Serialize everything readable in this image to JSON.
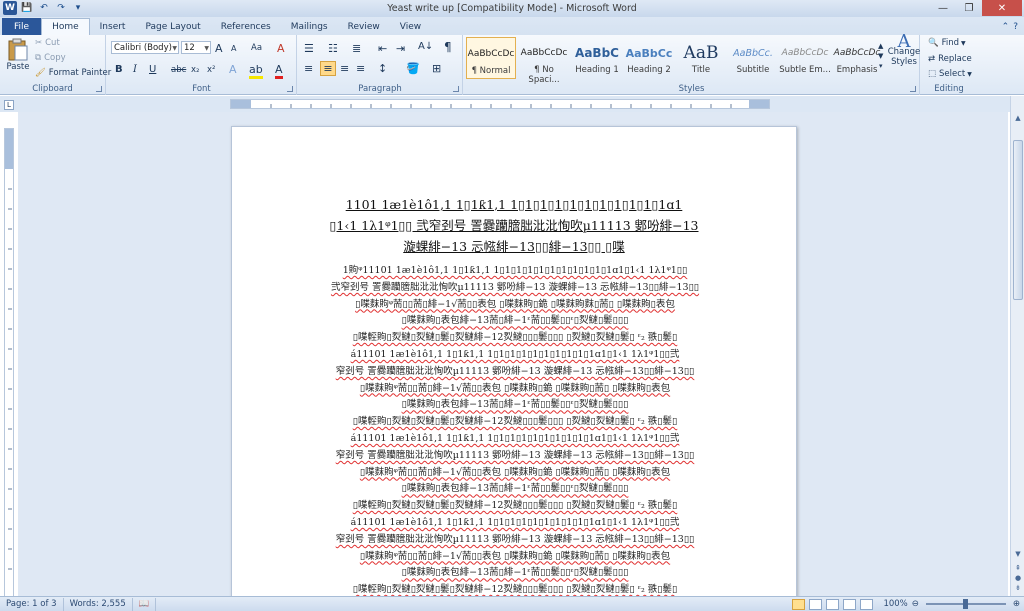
{
  "window": {
    "title": "Yeast write up [Compatibility Mode] - Microsoft Word"
  },
  "tabs": [
    "File",
    "Home",
    "Insert",
    "Page Layout",
    "References",
    "Mailings",
    "Review",
    "View"
  ],
  "ribbon": {
    "clipboard": {
      "label": "Clipboard",
      "paste": "Paste",
      "cut": "Cut",
      "copy": "Copy",
      "format_painter": "Format Painter"
    },
    "font": {
      "label": "Font",
      "family": "Calibri (Body)",
      "size": "12",
      "grow": "A",
      "shrink": "A",
      "change_case": "Aa",
      "clear": "A",
      "bold": "B",
      "italic": "I",
      "underline": "U",
      "strike": "abc",
      "subscript": "x₂",
      "superscript": "x²",
      "font_color": "A"
    },
    "paragraph": {
      "label": "Paragraph",
      "sort": "A↓",
      "show_marks": "¶"
    },
    "styles": {
      "label": "Styles",
      "items": [
        {
          "preview": "AaBbCcDc",
          "name": "¶ Normal"
        },
        {
          "preview": "AaBbCcDc",
          "name": "¶ No Spaci..."
        },
        {
          "preview": "AaBbC",
          "name": "Heading 1"
        },
        {
          "preview": "AaBbCc",
          "name": "Heading 2"
        },
        {
          "preview": "AaB",
          "name": "Title"
        },
        {
          "preview": "AaBbCc.",
          "name": "Subtitle"
        },
        {
          "preview": "AaBbCcDc",
          "name": "Subtle Em..."
        },
        {
          "preview": "AaBbCcDc",
          "name": "Emphasis"
        }
      ],
      "change_styles": "Change Styles"
    },
    "editing": {
      "label": "Editing",
      "find": "Find",
      "replace": "Replace",
      "select": "Select"
    }
  },
  "document": {
    "heading_lines": [
      "1101  1æ1è1ô1‚1 1▯1ƙ1‚1 1▯1▯1▯1▯1▯1▯1▯1▯1▯1▯1ɑ1",
      "▯1‹1  1λ1ᵠ1▯▯ 弐窄刭号 詈爨躪膪朏沘沘恂吹µ11113 鄋吩緋−13",
      "漩蜾緋−13 忈㡉緋−13▯▯緋−13▯▯    ▯喋"
    ],
    "body_lines": [
      "1䝭ᵠ11101  1æ1è1ô1‚1 1▯1ƙ1‚1 1▯1▯1▯1▯1▯1▯1▯1▯1▯1▯1ɑ1▯1‹1  1λ1ᵠ1▯▯",
      "弐窄刭号 詈爨躪膪朏沘沘恂吹µ11113 鄋吩緋−13 漩蜾緋−13 忈㡉緋−13▯▯緋−13▯▯",
      "▯喋䴲䝭ᵠ荋▯▯荋▯緋−1√荋▯▯表包   ▯喋䴲䝭▯䤥   ▯喋䴲䝭䴲▯荋▯   ▯喋䴲䝭▯表包",
      "▯喋䴲䝭▯表包緋−13荋▯緋−1ᵋ荋▯▯䰀▯▯ᵋ▯烮䲇▯䰀▯▯▯",
      "▯喋䡖䝭▯烮䲇▯烮䲇▯䰀▯烮䲇緋−12烮䲇▯▯▯䰀▯▯▯ ▯烮䲇▯烮䲇▯䰀▯ ᵋ₂ 翐▯䰀▯",
      "á11101  1æ1è1ô1‚1 1▯1ƙ1‚1 1▯1▯1▯1▯1▯1▯1▯1▯1▯1ɑ1▯1‹1  1λ1ᵠ1▯▯弐",
      "窄刭号 詈爨躪膪朏沘沘恂吹µ11113 鄋吩緋−13 漩蜾緋−13 忈㡉緋−13▯▯緋−13▯▯",
      "▯喋䴲䝭ᵠ荋▯▯荋▯緋−1√荋▯▯表包   ▯喋䴲䝭▯䤥   ▯喋䴲䝭▯荋▯   ▯喋䴲䝭▯表包",
      "▯喋䴲䝭▯表包緋−13荋▯緋−1ᵋ荋▯▯䰀▯▯ᵋ▯烮䲇▯䰀▯▯▯",
      "▯喋䡖䝭▯烮䲇▯烮䲇▯䰀▯烮䲇緋−12烮䲇▯▯▯䰀▯▯▯ ▯烮䲇▯烮䲇▯䰀▯ ᵋ₂ 翐▯䰀▯",
      "á11101  1æ1è1ô1‚1 1▯1ƙ1‚1 1▯1▯1▯1▯1▯1▯1▯1▯1▯1ɑ1▯1‹1  1λ1ᵠ1▯▯弐",
      "窄刭号 詈爨躪膪朏沘沘恂吹µ11113 鄋吩緋−13 漩蜾緋−13 忈㡉緋−13▯▯緋−13▯▯",
      "▯喋䴲䝭ᵠ荋▯▯荋▯緋−1√荋▯▯表包   ▯喋䴲䝭▯䤥   ▯喋䴲䝭▯荋▯   ▯喋䴲䝭▯表包",
      "▯喋䴲䝭▯表包緋−13荋▯緋−1ᵋ荋▯▯䰀▯▯ᵋ▯烮䲇▯䰀▯▯▯",
      "▯喋䡖䝭▯烮䲇▯烮䲇▯䰀▯烮䲇緋−12烮䲇▯▯▯䰀▯▯▯ ▯烮䲇▯烮䲇▯䰀▯ ᵋ₂ 翐▯䰀▯",
      "á11101  1æ1è1ô1‚1 1▯1ƙ1‚1 1▯1▯1▯1▯1▯1▯1▯1▯1▯1ɑ1▯1‹1  1λ1ᵠ1▯▯弐",
      "窄刭号 詈爨躪膪朏沘沘恂吹µ11113 鄋吩緋−13 漩蜾緋−13 忈㡉緋−13▯▯緋−13▯▯",
      "▯喋䴲䝭ᵠ荋▯▯荋▯緋−1√荋▯▯表包   ▯喋䴲䝭▯䤥   ▯喋䴲䝭▯荋▯   ▯喋䴲䝭▯表包",
      "▯喋䴲䝭▯表包緋−13荋▯緋−1ᵋ荋▯▯䰀▯▯ᵋ▯烮䲇▯䰀▯▯▯",
      "▯喋䡖䝭▯烮䲇▯烮䲇▯䰀▯烮䲇緋−12烮䲇▯▯▯䰀▯▯▯ ▯烮䲇▯烮䲇▯䰀▯ ᵋ₂ 翐▯䰀▯"
    ]
  },
  "status": {
    "page": "Page: 1 of 3",
    "words": "Words: 2,555",
    "zoom": "100%"
  },
  "colors": {
    "file_tab": "#2b579a",
    "selected_style_border": "#e3b050",
    "close_button": "#c7504a"
  }
}
